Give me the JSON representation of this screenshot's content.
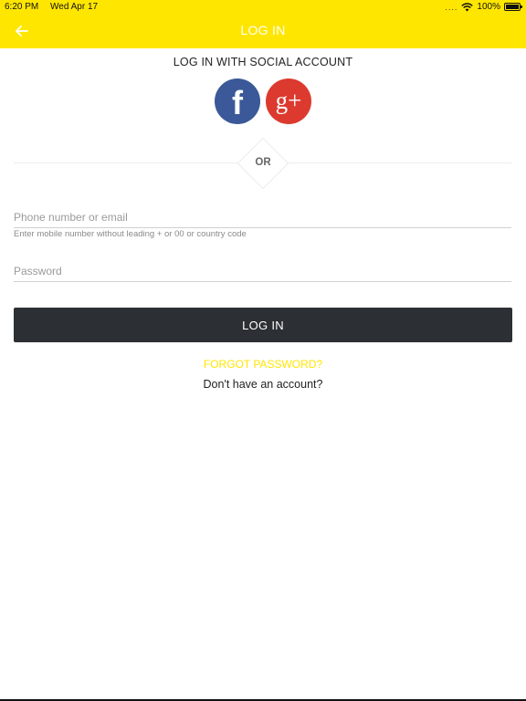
{
  "status_bar": {
    "time": "6:20 PM",
    "date": "Wed Apr 17",
    "signal": "....",
    "battery": "100%"
  },
  "header": {
    "title": "LOG IN",
    "back_icon": "arrow-left-icon",
    "background_color": "#ffe600"
  },
  "social": {
    "heading": "LOG IN WITH SOCIAL ACCOUNT",
    "facebook": {
      "icon": "facebook-icon",
      "glyph": "f",
      "color": "#3b5998"
    },
    "google_plus": {
      "icon": "google-plus-icon",
      "glyph": "g+",
      "color": "#dc3a2f"
    }
  },
  "divider": {
    "label": "OR"
  },
  "form": {
    "phone_placeholder": "Phone number or email",
    "phone_helper": "Enter mobile number without leading + or 00 or country code",
    "password_placeholder": "Password",
    "login_label": "LOG IN"
  },
  "links": {
    "forgot_password": "FORGOT PASSWORD?",
    "signup": "Don't have an account?"
  }
}
